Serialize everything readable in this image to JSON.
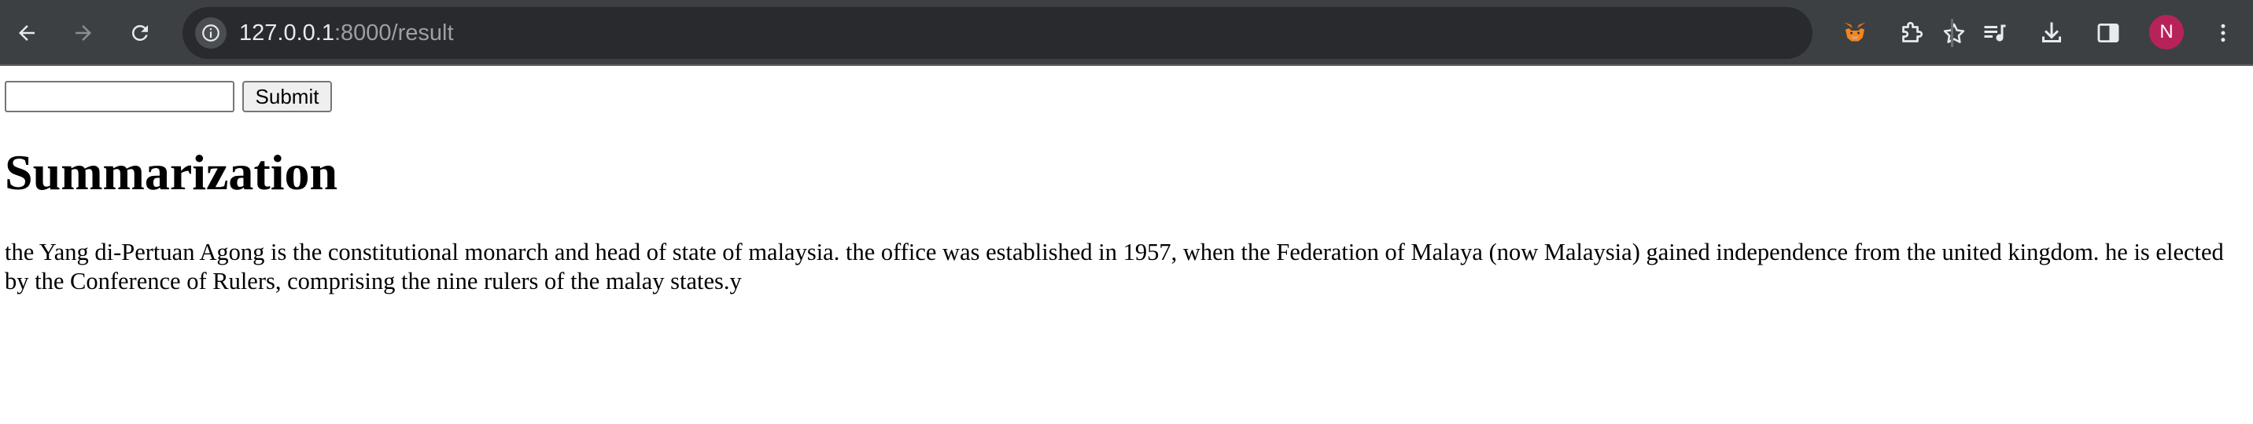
{
  "browser": {
    "url_host": "127.0.0.1",
    "url_rest": ":8000/result",
    "profile_initial": "N",
    "icons": [
      "back-icon",
      "forward-icon",
      "reload-icon",
      "site-info-icon",
      "bookmark-star-icon",
      "metamask-fox-icon",
      "extensions-puzzle-icon",
      "reading-list-icon",
      "download-icon",
      "side-panel-icon",
      "menu-kebab-icon"
    ],
    "colors": {
      "toolbar": "#3c4043",
      "omnibox": "#282a2d",
      "avatar": "#b8225a"
    }
  },
  "form": {
    "input_value": "",
    "input_placeholder": "",
    "submit_label": "Submit"
  },
  "content": {
    "heading": "Summarization",
    "summary": "the Yang di-Pertuan Agong is the constitutional monarch and head of state of malaysia. the office was established in 1957, when the Federation of Malaya (now Malaysia) gained independence from the united kingdom. he is elected by the Conference of Rulers, comprising the nine rulers of the malay states.y"
  }
}
